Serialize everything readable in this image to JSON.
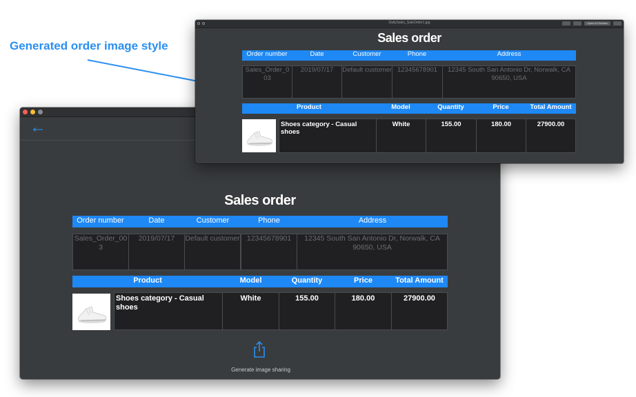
{
  "caption": "Generated order image style",
  "main_window": {
    "share_label": "Generate image sharing"
  },
  "preview_window": {
    "filename": "DailySales_SaleOrder1.jpg",
    "controls": [
      "",
      "",
      "Open in Preview",
      ""
    ]
  },
  "order": {
    "title": "Sales order",
    "info_headers": [
      "Order number",
      "Date",
      "Customer",
      "Phone",
      "Address"
    ],
    "info_values": [
      "Sales_Order_003",
      "2019/07/17",
      "Default customer",
      "12345678901",
      "12345 South San Antonio Dr, Norwalk, CA 90650, USA"
    ],
    "product_headers": [
      "Product",
      "Model",
      "Quantity",
      "Price",
      "Total Amount"
    ],
    "product_row": {
      "name": "Shoes category - Casual shoes",
      "model": "White",
      "quantity": "155.00",
      "price": "180.00",
      "total": "27900.00"
    }
  }
}
